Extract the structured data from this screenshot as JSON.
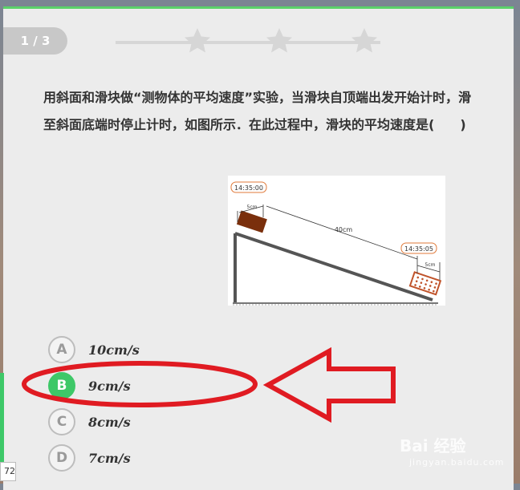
{
  "progress": {
    "label": "1 / 3"
  },
  "question": {
    "text": "用斜面和滑块做“测物体的平均速度”实验，当滑块自顶端出发开始计时，滑至斜面底端时停止计时，如图所示．在此过程中，滑块的平均速度是(　　)"
  },
  "figure": {
    "start_time": "14:35:00",
    "end_time": "14:35:05",
    "block_len_top": "5cm",
    "distance": "40cm",
    "block_len_bottom": "5cm"
  },
  "options": [
    {
      "letter": "A",
      "text": "10cm/s",
      "correct": false
    },
    {
      "letter": "B",
      "text": "9cm/s",
      "correct": true
    },
    {
      "letter": "C",
      "text": "8cm/s",
      "correct": false
    },
    {
      "letter": "D",
      "text": "7cm/s",
      "correct": false
    }
  ],
  "page_tag": "72",
  "watermark": {
    "brand": "Bai 经验",
    "url": "jingyan.baidu.com"
  },
  "colors": {
    "accent_green": "#3ec868",
    "annotation_red": "#e01b22",
    "top_bar": "#5bd36a"
  }
}
